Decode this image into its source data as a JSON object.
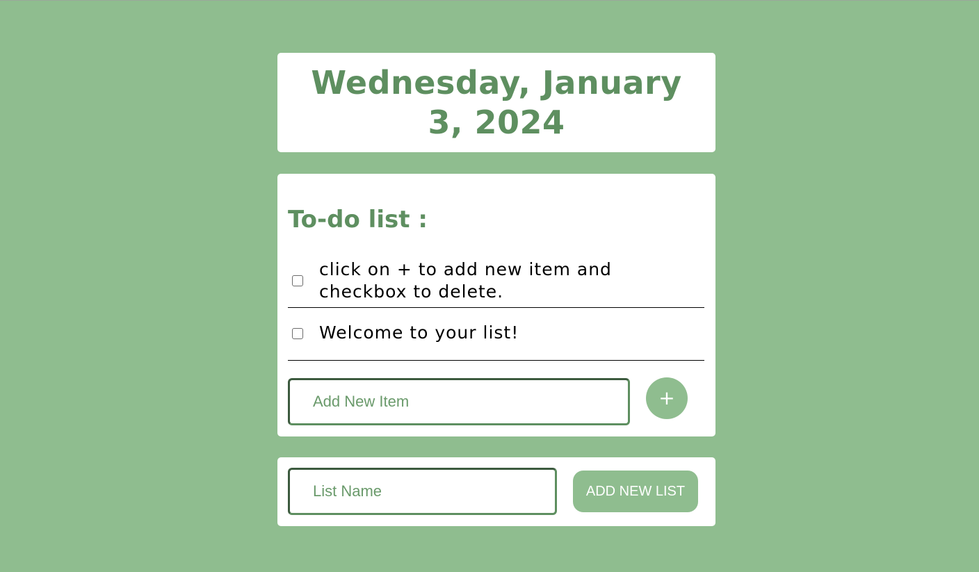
{
  "header": {
    "date": "Wednesday, January 3, 2024"
  },
  "todo": {
    "title": "To-do list :",
    "items": [
      {
        "text": "click on + to add new item and checkbox to delete.",
        "checked": false
      },
      {
        "text": "Welcome to your list!",
        "checked": false
      }
    ],
    "new_item": {
      "placeholder": "Add New Item",
      "value": ""
    },
    "add_button_label": "+"
  },
  "new_list": {
    "placeholder": "List Name",
    "value": "",
    "button_label": "ADD NEW LIST"
  },
  "colors": {
    "background": "#8fbd8f",
    "accent": "#5e8f60",
    "card": "#ffffff"
  }
}
